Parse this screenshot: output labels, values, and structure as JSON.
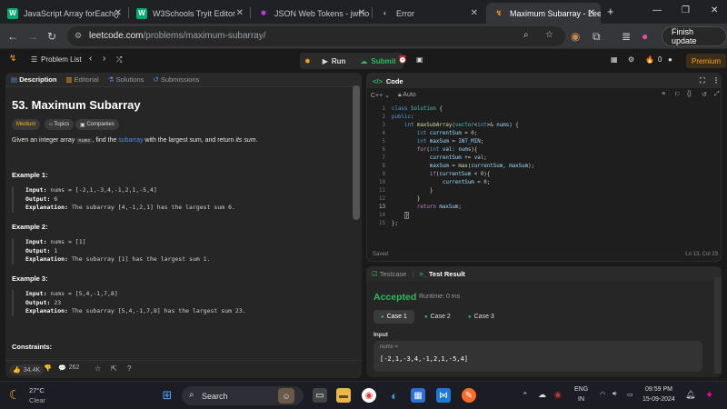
{
  "browser": {
    "tabs": [
      {
        "title": "JavaScript Array forEach()",
        "favicon": "W",
        "favicon_color": "#04aa6d"
      },
      {
        "title": "W3Schools Tryit Editor",
        "favicon": "W",
        "favicon_color": "#04aa6d"
      },
      {
        "title": "JSON Web Tokens - jwt.io",
        "favicon": "✱",
        "favicon_color": "#d63aff"
      },
      {
        "title": "Error",
        "favicon": "◐",
        "favicon_color": "#888888"
      },
      {
        "title": "Maximum Subarray - Lee",
        "favicon": "↯",
        "favicon_color": "#ffa116"
      }
    ],
    "new_tab": "+",
    "url_host": "leetcode.com",
    "url_path": "/problems/maximum-subarray/",
    "finish_update": "Finish update"
  },
  "lc_bar": {
    "problem_list": "Problem List",
    "run": "Run",
    "submit": "Submit",
    "streak": "0",
    "premium": "Premium"
  },
  "left": {
    "tabs": [
      "Description",
      "Editorial",
      "Solutions",
      "Submissions"
    ],
    "title": "53. Maximum Subarray",
    "chips": [
      "Medium",
      "Topics",
      "Companies"
    ],
    "desc_pre": "Given an integer array ",
    "desc_code": "nums",
    "desc_mid": ", find the ",
    "desc_link": "subarray",
    "desc_post": " with the largest sum, and return ",
    "desc_em": "its sum",
    "desc_end": ".",
    "examples": [
      {
        "title": "Example 1:",
        "input": "nums = [-2,1,-3,4,-1,2,1,-5,4]",
        "output": "6",
        "explanation": "The subarray [4,-1,2,1] has the largest sum 6."
      },
      {
        "title": "Example 2:",
        "input": "nums = [1]",
        "output": "1",
        "explanation": "The subarray [1] has the largest sum 1."
      },
      {
        "title": "Example 3:",
        "input": "nums = [5,4,-1,7,8]",
        "output": "23",
        "explanation": "The subarray [5,4,-1,7,8] has the largest sum 23."
      }
    ],
    "labels": {
      "input": "Input:",
      "output": "Output:",
      "explanation": "Explanation:"
    },
    "constraints": "Constraints:",
    "likes": "34.4K",
    "comments": "262"
  },
  "code": {
    "header": "Code",
    "language": "C++",
    "auto": "Auto",
    "saved": "Saved",
    "cursor": "Ln 13, Col 23"
  },
  "test": {
    "tab_testcase": "Testcase",
    "tab_result": "Test Result",
    "status": "Accepted",
    "runtime": "Runtime: 0 ms",
    "cases": [
      "Case 1",
      "Case 2",
      "Case 3"
    ],
    "input_label": "Input",
    "param_name": "nums =",
    "param_value": "[-2,1,-3,4,-1,2,1,-5,4]"
  },
  "taskbar": {
    "temp": "27°C",
    "weather": "Clear",
    "search": "Search",
    "lang1": "ENG",
    "lang2": "IN",
    "time": "09:59 PM",
    "date": "15-09-2024"
  }
}
